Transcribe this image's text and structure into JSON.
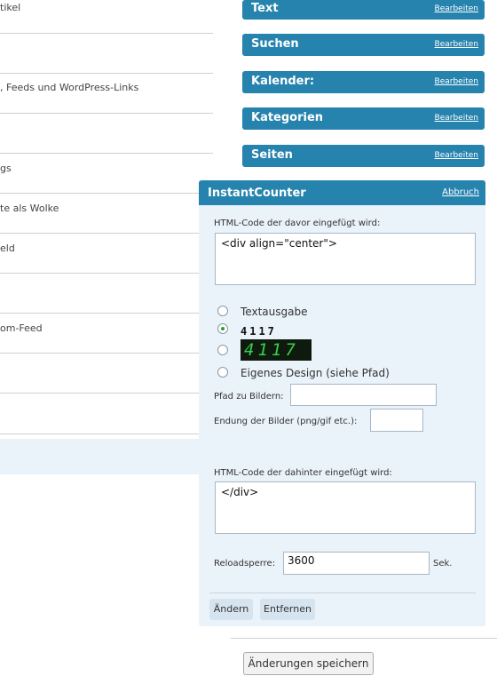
{
  "left_list": {
    "items": [
      {
        "label": "tikel"
      },
      {
        "label": ""
      },
      {
        "label": ", Feeds und WordPress-Links"
      },
      {
        "label": ""
      },
      {
        "label": "gs"
      },
      {
        "label": "te als Wolke"
      },
      {
        "label": "eld"
      },
      {
        "label": ""
      },
      {
        "label": "om-Feed"
      },
      {
        "label": ""
      },
      {
        "label": ""
      }
    ]
  },
  "widget_bars": [
    {
      "title": "Text",
      "edit": "Bearbeiten"
    },
    {
      "title": "Suchen",
      "edit": "Bearbeiten"
    },
    {
      "title": "Kalender:",
      "edit": "Bearbeiten"
    },
    {
      "title": "Kategorien",
      "edit": "Bearbeiten"
    },
    {
      "title": "Seiten",
      "edit": "Bearbeiten"
    }
  ],
  "widget": {
    "title": "InstantCounter",
    "cancel": "Abbruch",
    "before_label": "HTML-Code der davor eingefügt wird:",
    "before_value": "<div align=\"center\">",
    "options": {
      "text": "Textausgabe",
      "digits_dark": "4117",
      "digits_lcd": "4117",
      "custom": "Eigenes Design (siehe Pfad)"
    },
    "path_label": "Pfad zu Bildern:",
    "path_value": "",
    "ext_label": "Endung der Bilder (png/gif etc.):",
    "ext_value": "",
    "after_label": "HTML-Code der dahinter eingefügt wird:",
    "after_value": "</div>",
    "reload_label": "Reloadsperre:",
    "reload_value": "3600",
    "reload_unit": "Sek.",
    "change_button": "Ändern",
    "remove_button": "Entfernen"
  },
  "save_button": "Änderungen speichern",
  "colors": {
    "accent": "#2683ae",
    "panel": "#eaf2fa"
  }
}
